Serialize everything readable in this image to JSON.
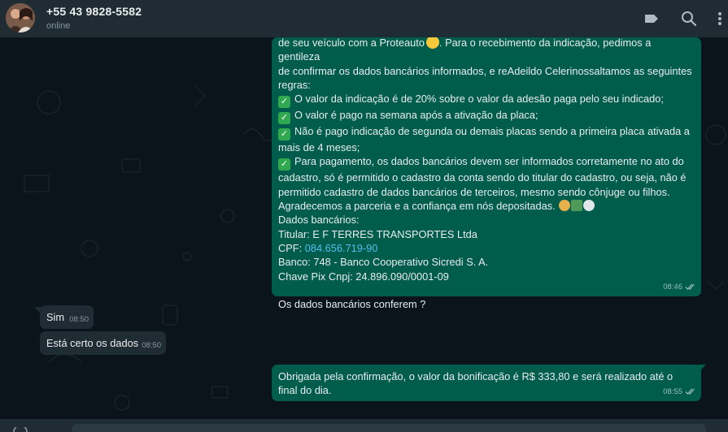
{
  "header": {
    "contact_name": "+55 43 9828-5582",
    "status": "online",
    "icons": [
      "label-icon",
      "search-icon",
      "menu-icon"
    ]
  },
  "messages": [
    {
      "direction": "outgoing",
      "lines": [
        "de seu veículo com a Proteauto",
        ". Para o recebimento da indicação, pedimos a gentileza",
        "de confirmar os dados bancários informados, e reAdeildo Celerinossaltamos as seguintes",
        "regras:",
        "O valor da indicação é de 20% sobre o valor da adesão paga pelo seu indicado;",
        "O valor é pago na semana após a ativação da placa;",
        "Não é pago indicação de segunda ou demais placas sendo a primeira placa ativada a",
        "mais de 4 meses;",
        "Para pagamento, os dados bancários devem ser informados corretamente no ato do",
        "cadastro, só é permitido o cadastro da conta sendo do titular do cadastro, ou seja, não é",
        "permitido cadastro de dados bancários de terceiros, mesmo sendo cônjuge ou filhos.",
        "Agradecemos a parceria e a confiança em nós depositadas.",
        "Dados bancários:",
        "Titular: E F TERRES TRANSPORTES Ltda",
        "CPF: ",
        "084.656.719-90",
        "Banco: 748 - Banco Cooperativo Sicredi S. A.",
        "Chave Pix Cnpj: 24.896.090/0001-09",
        "Os dados bancários conferem ?"
      ],
      "time": "08:46",
      "status": "read"
    },
    {
      "direction": "incoming",
      "text": "Sim",
      "time": "08:50"
    },
    {
      "direction": "incoming",
      "text": "Está certo os dados",
      "time": "08:50"
    },
    {
      "direction": "outgoing",
      "text": "Obrigada pela confirmação, o valor da bonificação é R$ 333,80 e será realizado até o final do dia.",
      "time": "08:55",
      "status": "read"
    }
  ],
  "colors": {
    "chat_bg": "#0b141a",
    "header_bg": "#202c33",
    "outgoing_bubble": "#005c4b",
    "incoming_bubble": "#202c33",
    "link": "#53bdeb",
    "check_emoji": "#2fa84f"
  }
}
